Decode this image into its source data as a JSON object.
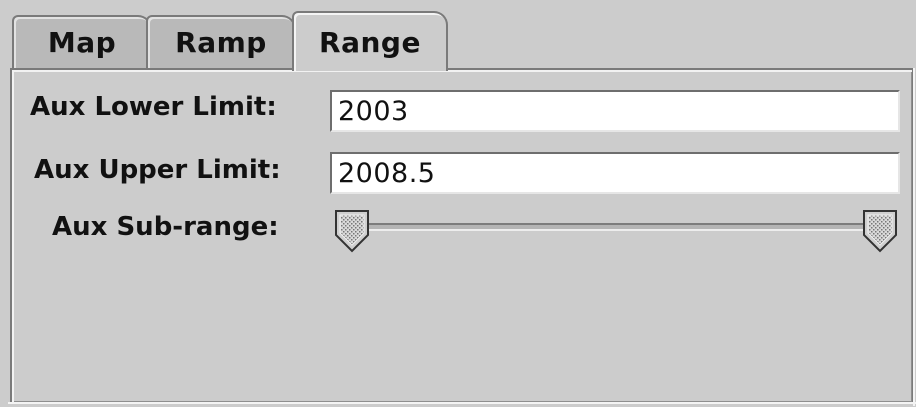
{
  "tabs": [
    {
      "label": "Map",
      "active": false
    },
    {
      "label": "Ramp",
      "active": false
    },
    {
      "label": "Range",
      "active": true
    }
  ],
  "form": {
    "lower_label": "Aux Lower Limit:",
    "lower_value": "2003",
    "upper_label": "Aux Upper Limit:",
    "upper_value": "2008.5",
    "subrange_label": "Aux Sub-range:",
    "subrange": {
      "low": 0.0,
      "high": 1.0
    }
  },
  "icons": {
    "slider_thumb": "slider-thumb-icon"
  },
  "colors": {
    "background": "#cccccc",
    "field_background": "#ffffff",
    "border": "#7a7a7a"
  }
}
